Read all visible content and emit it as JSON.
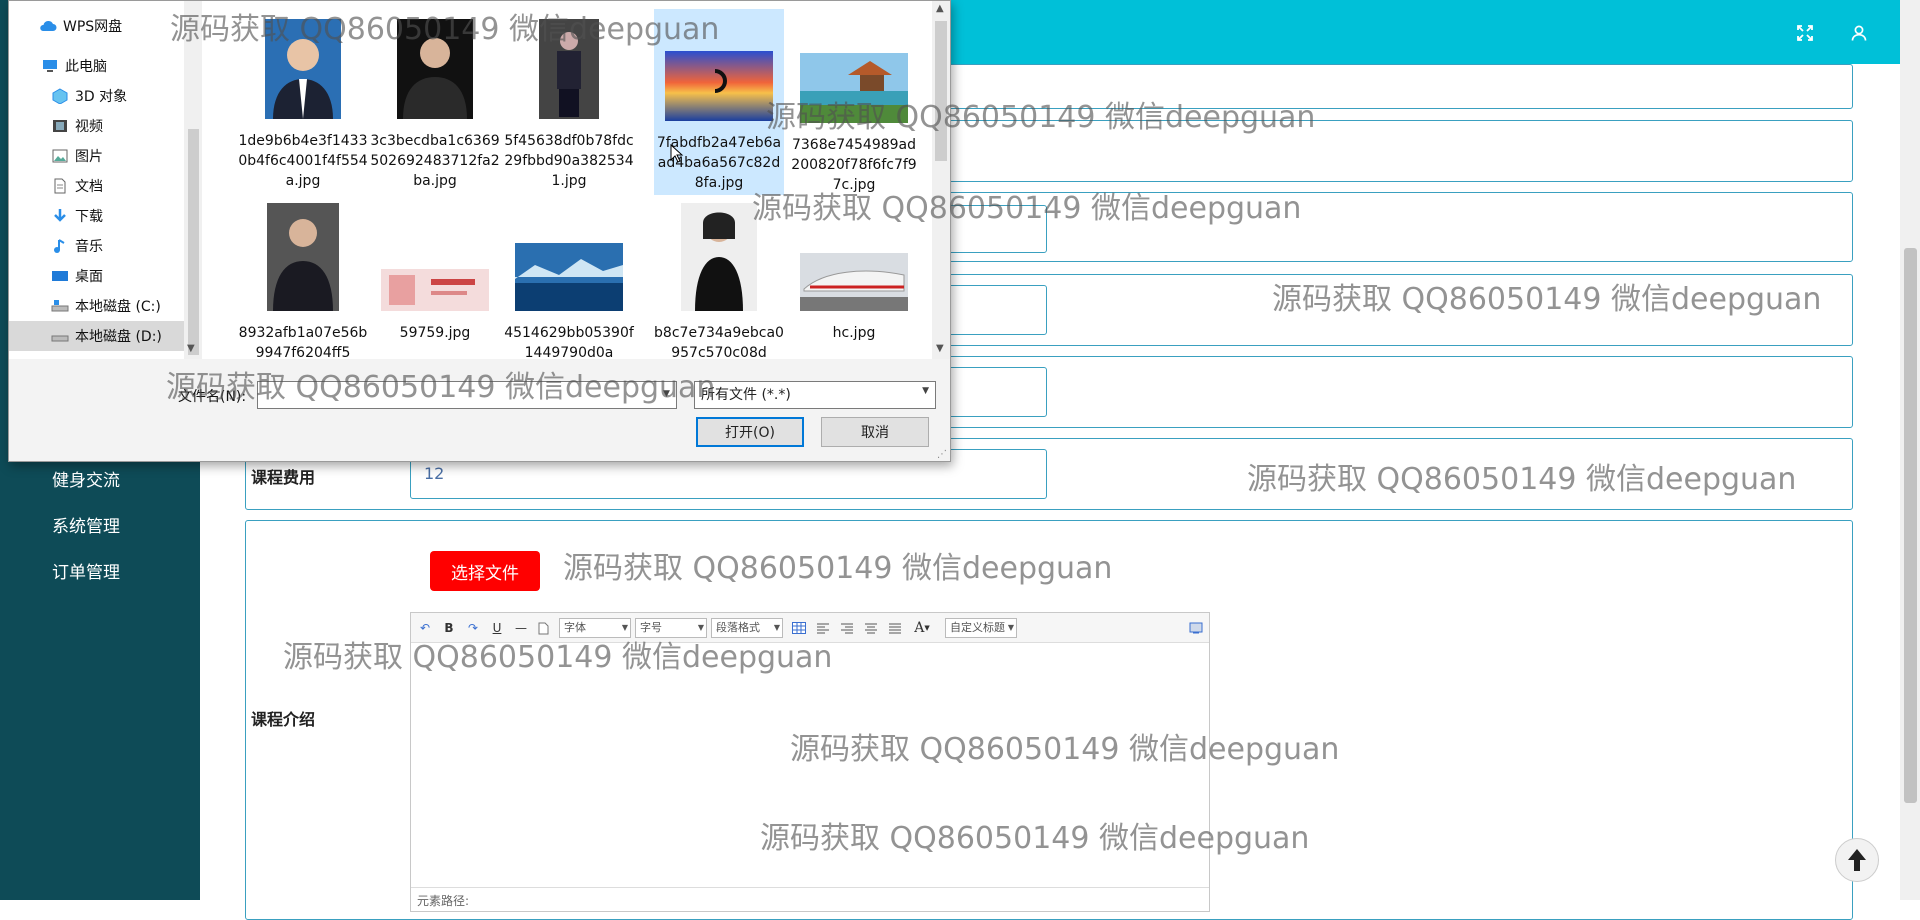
{
  "sidebar": {
    "items": [
      {
        "label": "健身交流"
      },
      {
        "label": "系统管理"
      },
      {
        "label": "订单管理"
      }
    ]
  },
  "header": {
    "icons": [
      "fullscreen-icon",
      "user-icon"
    ]
  },
  "form": {
    "fee_label": "课程费用",
    "fee_value": "12",
    "intro_label": "课程介绍",
    "choose_file_label": "选择文件"
  },
  "editor": {
    "toolbar": {
      "bold": "B",
      "underline": "U",
      "font_family": "字体",
      "font_size": "字号",
      "paragraph_format": "段落格式",
      "font_color": "A",
      "custom_title": "自定义标题"
    },
    "status_label": "元素路径:"
  },
  "dialog": {
    "tree": [
      {
        "label": "WPS网盘",
        "icon": "cloud-icon"
      },
      {
        "label": "此电脑",
        "icon": "computer-icon"
      },
      {
        "label": "3D 对象",
        "icon": "cube-icon"
      },
      {
        "label": "视频",
        "icon": "video-icon"
      },
      {
        "label": "图片",
        "icon": "picture-icon"
      },
      {
        "label": "文档",
        "icon": "document-icon"
      },
      {
        "label": "下载",
        "icon": "download-icon"
      },
      {
        "label": "音乐",
        "icon": "music-icon"
      },
      {
        "label": "桌面",
        "icon": "desktop-icon"
      },
      {
        "label": "本地磁盘 (C:)",
        "icon": "drive-icon"
      },
      {
        "label": "本地磁盘 (D:)",
        "icon": "drive-icon"
      }
    ],
    "files": [
      {
        "name": "1de9b6b4e3f14330b4f6c4001f4f554a.jpg"
      },
      {
        "name": "3c3becdba1c6369502692483712fa2ba.jpg"
      },
      {
        "name": "5f45638df0b78fdc29fbbd90a3825341.jpg"
      },
      {
        "name": "7fabdfb2a47eb6aad4ba6a567c82d8fa.jpg"
      },
      {
        "name": "7368e7454989ad200820f78f6fc7f97c.jpg"
      },
      {
        "name": "8932afb1a07e56b9947f6204ff5"
      },
      {
        "name": "59759.jpg"
      },
      {
        "name": "4514629bb05390f1449790d0a"
      },
      {
        "name": "b8c7e734a9ebca0957c570c08d"
      },
      {
        "name": "hc.jpg"
      }
    ],
    "filename_label": "文件名(N):",
    "filename_value": "",
    "filetype_value": "所有文件 (*.*)",
    "open_label": "打开(O)",
    "cancel_label": "取消"
  },
  "watermark": "源码获取 QQ86050149 微信deepguan"
}
